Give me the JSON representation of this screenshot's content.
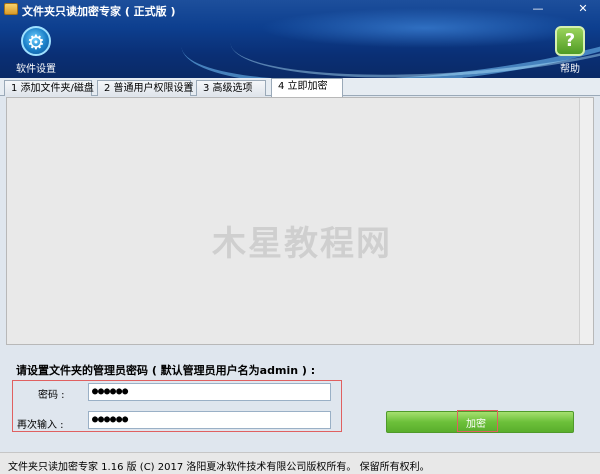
{
  "window": {
    "title": "文件夹只读加密专家 ( 正式版 )",
    "minimize_glyph": "—",
    "close_glyph": "✕"
  },
  "toolbar": {
    "settings_label": "软件设置",
    "settings_icon": "gear-icon",
    "help_label": "帮助",
    "help_icon": "help-icon",
    "help_glyph": "?"
  },
  "tabs": [
    {
      "label": "1 添加文件夹/磁盘",
      "active": false
    },
    {
      "label": "2 普通用户权限设置",
      "active": false
    },
    {
      "label": "3 高级选项",
      "active": false
    },
    {
      "label": "4 立即加密",
      "active": true
    }
  ],
  "watermark": "木星教程网",
  "form": {
    "prompt": "请设置文件夹的管理员密码 ( 默认管理员用户名为admin ) :",
    "password_label": "密码 :",
    "password_value": "●●●●●●",
    "repeat_label": "再次输入 :",
    "repeat_value": "●●●●●●",
    "encrypt_button": "加密"
  },
  "status": {
    "text": "文件夹只读加密专家 1.16 版  (C)  2017 洛阳夏冰软件技术有限公司版权所有。  保留所有权利。"
  },
  "colors": {
    "header_bg": "#0d3f8f",
    "encrypt_button": "#6cc03a",
    "highlight_box": "#e06060"
  }
}
